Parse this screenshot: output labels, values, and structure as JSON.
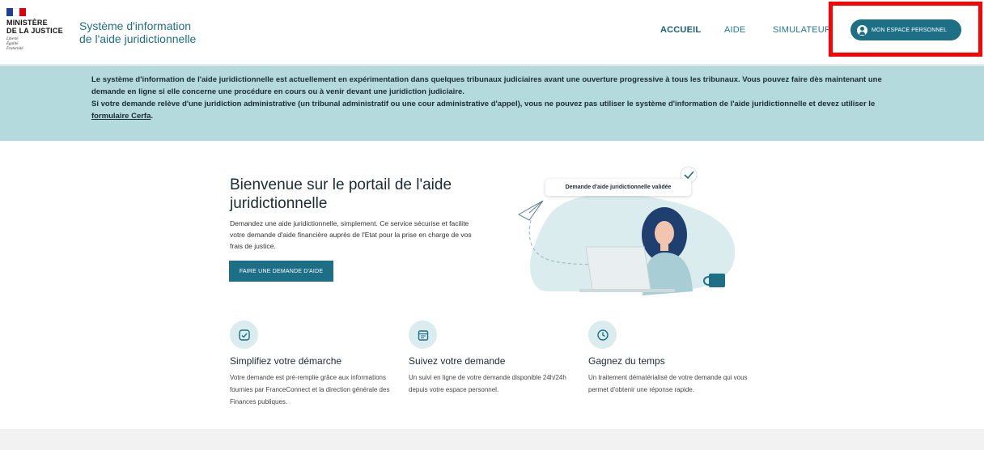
{
  "header": {
    "logo": {
      "line1": "MINISTÈRE",
      "line2": "DE LA JUSTICE",
      "motto": [
        "Liberté",
        "Égalité",
        "Fraternité"
      ]
    },
    "site_title_line1": "Système d'information",
    "site_title_line2": "de l'aide juridictionnelle",
    "nav": [
      {
        "label": "ACCUEIL",
        "active": true
      },
      {
        "label": "AIDE",
        "active": false
      },
      {
        "label": "SIMULATEUR",
        "active": false
      }
    ],
    "espace_button": "MON ESPACE PERSONNEL"
  },
  "banner": {
    "line1": "Le système d'information de l'aide juridictionnelle est actuellement en expérimentation dans quelques tribunaux judiciaires avant une ouverture progressive à tous les tribunaux. Vous pouvez faire dès maintenant une demande en ligne si elle concerne une procédure en cours ou à venir devant une juridiction judiciaire.",
    "line2": "Si votre demande relève d'une juridiction administrative (un tribunal administratif ou une cour administrative d'appel), vous ne pouvez pas utiliser le système d'information de l'aide juridictionnelle et devez utiliser le",
    "link": "formulaire Cerfa",
    "end": "."
  },
  "hero": {
    "title": "Bienvenue sur le portail de l'aide juridictionnelle",
    "description": "Demandez une aide juridictionnelle, simplement. Ce service sécurise et facilite votre demande d'aide financière auprès de l'Etat pour la prise en charge de vos frais de justice.",
    "cta": "FAIRE UNE DEMANDE D'AIDE",
    "illustration_badge": "Demande d'aide juridictionnelle validée"
  },
  "features": [
    {
      "icon": "checklist-icon",
      "title": "Simplifiez votre démarche",
      "description": "Votre demande est pré-remplie grâce aux informations fournies par FranceConnect et la direction générale des Finances publiques."
    },
    {
      "icon": "calendar-icon",
      "title": "Suivez votre demande",
      "description": "Un suivi en ligne de votre demande disponible 24h/24h depuis votre espace personnel."
    },
    {
      "icon": "clock-icon",
      "title": "Gagnez du temps",
      "description": "Un traitement dématérialisé de votre demande qui vous permet d'obtenir une réponse rapide."
    }
  ],
  "colors": {
    "primary": "#1d6f86",
    "banner_bg": "#b4dade",
    "highlight": "#ff0000"
  }
}
